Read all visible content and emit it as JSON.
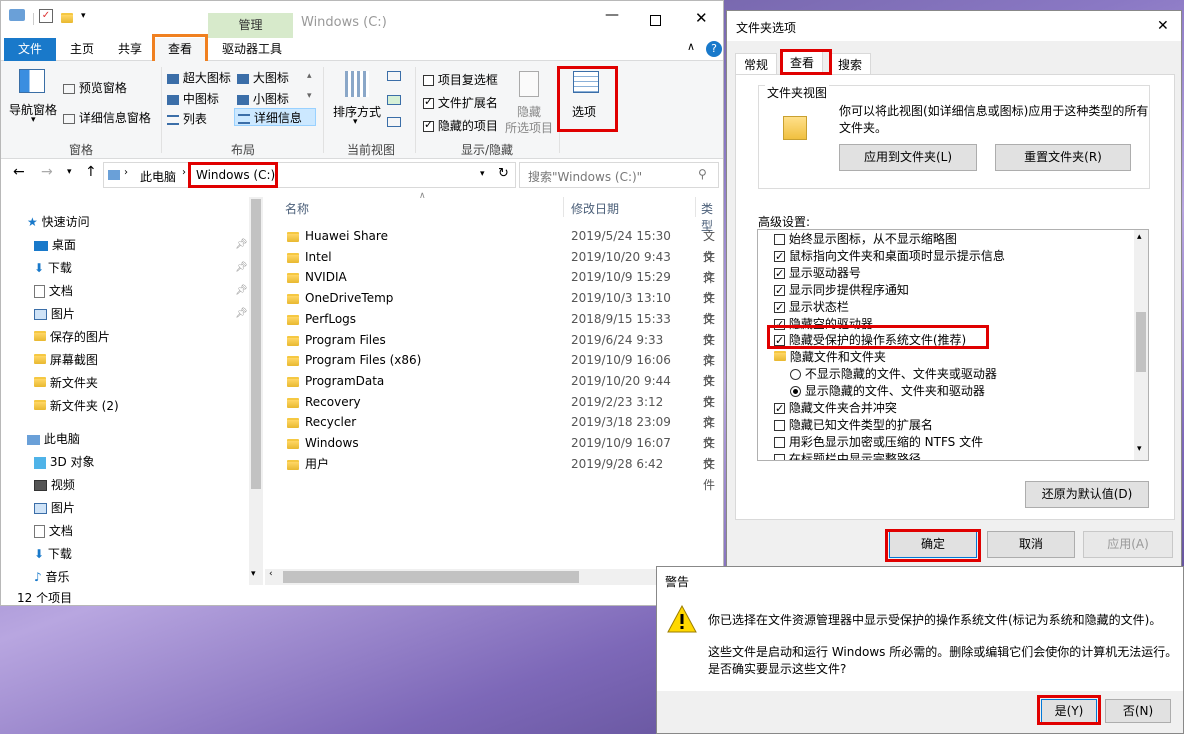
{
  "explorer": {
    "title": "Windows (C:)",
    "context_tab": "管理",
    "tabs": [
      "文件",
      "主页",
      "共享",
      "查看",
      "驱动器工具"
    ],
    "ribbon": {
      "nav_pane": "导航窗格",
      "preview_pane": "预览窗格",
      "details_pane": "详细信息窗格",
      "group_panes": "窗格",
      "layout": [
        "超大图标",
        "大图标",
        "中图标",
        "小图标",
        "列表",
        "详细信息"
      ],
      "group_layout": "布局",
      "sort_by": "排序方式",
      "group_current_view": "当前视图",
      "item_checkboxes": "项目复选框",
      "file_extensions": "文件扩展名",
      "hidden_items": "隐藏的项目",
      "hide_selected_1": "隐藏",
      "hide_selected_2": "所选项目",
      "group_show_hide": "显示/隐藏",
      "options": "选项"
    },
    "address": {
      "this_pc": "此电脑",
      "drive": "Windows (C:)",
      "search_placeholder": "搜索\"Windows (C:)\""
    },
    "columns": {
      "name": "名称",
      "date": "修改日期",
      "type": "类型"
    },
    "nav": {
      "quick_access": "快速访问",
      "quick_items": [
        "桌面",
        "下载",
        "文档",
        "图片",
        "保存的图片",
        "屏幕截图",
        "新文件夹",
        "新文件夹 (2)"
      ],
      "this_pc": "此电脑",
      "pc_items": [
        "3D 对象",
        "视频",
        "图片",
        "文档",
        "下载",
        "音乐"
      ]
    },
    "files": [
      {
        "name": "Huawei Share",
        "date": "2019/5/24 15:30",
        "type": "文件"
      },
      {
        "name": "Intel",
        "date": "2019/10/20 9:43",
        "type": "文件"
      },
      {
        "name": "NVIDIA",
        "date": "2019/10/9 15:29",
        "type": "文件"
      },
      {
        "name": "OneDriveTemp",
        "date": "2019/10/3 13:10",
        "type": "文件"
      },
      {
        "name": "PerfLogs",
        "date": "2018/9/15 15:33",
        "type": "文件"
      },
      {
        "name": "Program Files",
        "date": "2019/6/24 9:33",
        "type": "文件"
      },
      {
        "name": "Program Files (x86)",
        "date": "2019/10/9 16:06",
        "type": "文件"
      },
      {
        "name": "ProgramData",
        "date": "2019/10/20 9:44",
        "type": "文件"
      },
      {
        "name": "Recovery",
        "date": "2019/2/23 3:12",
        "type": "文件"
      },
      {
        "name": "Recycler",
        "date": "2019/3/18 23:09",
        "type": "文件"
      },
      {
        "name": "Windows",
        "date": "2019/10/9 16:07",
        "type": "文件"
      },
      {
        "name": "用户",
        "date": "2019/9/28 6:42",
        "type": "文件"
      }
    ],
    "status": "12 个项目"
  },
  "dialog": {
    "title": "文件夹选项",
    "tabs": [
      "常规",
      "查看",
      "搜索"
    ],
    "folder_view_heading": "文件夹视图",
    "folder_view_desc_1": "你可以将此视图(如详细信息或图标)应用于这种类型的所有",
    "folder_view_desc_2": "文件夹。",
    "apply_to_folders": "应用到文件夹(L)",
    "reset_folders": "重置文件夹(R)",
    "advanced_heading": "高级设置:",
    "advanced_items": [
      {
        "kind": "cb",
        "checked": false,
        "label": "始终显示图标，从不显示缩略图"
      },
      {
        "kind": "cb",
        "checked": true,
        "label": "鼠标指向文件夹和桌面项时显示提示信息"
      },
      {
        "kind": "cb",
        "checked": true,
        "label": "显示驱动器号"
      },
      {
        "kind": "cb",
        "checked": true,
        "label": "显示同步提供程序通知"
      },
      {
        "kind": "cb",
        "checked": true,
        "label": "显示状态栏"
      },
      {
        "kind": "cb",
        "checked": true,
        "label": "隐藏空的驱动器"
      },
      {
        "kind": "cb",
        "checked": true,
        "label": "隐藏受保护的操作系统文件(推荐)"
      },
      {
        "kind": "folder",
        "checked": false,
        "label": "隐藏文件和文件夹"
      },
      {
        "kind": "radio",
        "checked": false,
        "label": "不显示隐藏的文件、文件夹或驱动器"
      },
      {
        "kind": "radio",
        "checked": true,
        "label": "显示隐藏的文件、文件夹和驱动器"
      },
      {
        "kind": "cb",
        "checked": true,
        "label": "隐藏文件夹合并冲突"
      },
      {
        "kind": "cb",
        "checked": false,
        "label": "隐藏已知文件类型的扩展名"
      },
      {
        "kind": "cb",
        "checked": false,
        "label": "用彩色显示加密或压缩的 NTFS 文件"
      },
      {
        "kind": "cb",
        "checked": false,
        "label": "在标题栏中显示完整路径"
      }
    ],
    "restore_defaults": "还原为默认值(D)",
    "ok": "确定",
    "cancel": "取消",
    "apply": "应用(A)"
  },
  "warning": {
    "title": "警告",
    "line1": "你已选择在文件资源管理器中显示受保护的操作系统文件(标记为系统和隐藏的文件)。",
    "line2": "这些文件是启动和运行 Windows 所必需的。删除或编辑它们会使你的计算机无法运行。",
    "line3": "是否确实要显示这些文件?",
    "yes": "是(Y)",
    "no": "否(N)"
  }
}
